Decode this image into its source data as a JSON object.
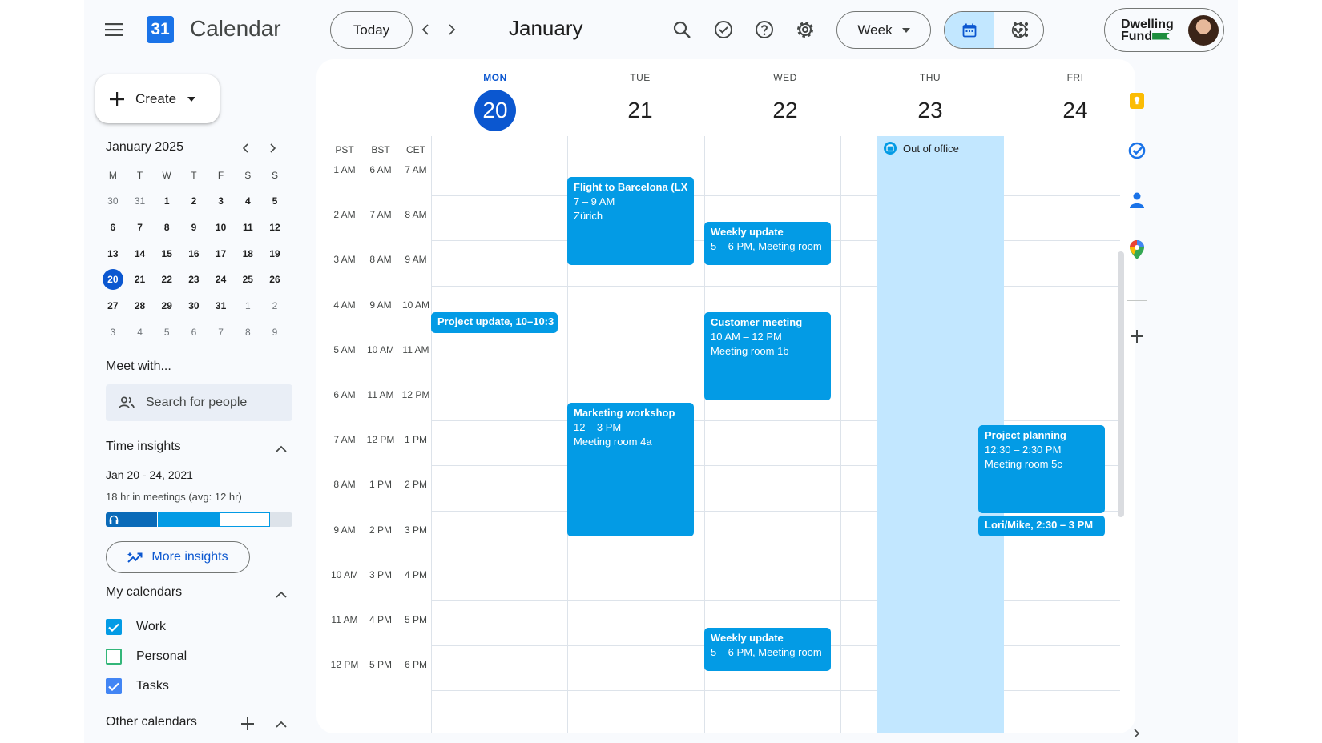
{
  "header": {
    "app_title": "Calendar",
    "logo_text": "31",
    "today_label": "Today",
    "month_title": "January",
    "view_label": "Week",
    "brand_line1": "Dwelling",
    "brand_line2": "Fund"
  },
  "sidebar": {
    "create_label": "Create",
    "mini_month_title": "January 2025",
    "weekday_initials": [
      "M",
      "T",
      "W",
      "T",
      "F",
      "S",
      "S"
    ],
    "mini_days": [
      {
        "d": "30",
        "muted": true
      },
      {
        "d": "31",
        "muted": true
      },
      {
        "d": "1"
      },
      {
        "d": "2"
      },
      {
        "d": "3"
      },
      {
        "d": "4"
      },
      {
        "d": "5"
      },
      {
        "d": "6"
      },
      {
        "d": "7"
      },
      {
        "d": "8"
      },
      {
        "d": "9"
      },
      {
        "d": "10"
      },
      {
        "d": "11"
      },
      {
        "d": "12"
      },
      {
        "d": "13"
      },
      {
        "d": "14"
      },
      {
        "d": "15"
      },
      {
        "d": "16"
      },
      {
        "d": "17"
      },
      {
        "d": "18"
      },
      {
        "d": "19"
      },
      {
        "d": "20",
        "selected": true
      },
      {
        "d": "21"
      },
      {
        "d": "22"
      },
      {
        "d": "23"
      },
      {
        "d": "24"
      },
      {
        "d": "25"
      },
      {
        "d": "26"
      },
      {
        "d": "27"
      },
      {
        "d": "28"
      },
      {
        "d": "29"
      },
      {
        "d": "30"
      },
      {
        "d": "31"
      },
      {
        "d": "1",
        "muted": true
      },
      {
        "d": "2",
        "muted": true
      },
      {
        "d": "3",
        "muted": true
      },
      {
        "d": "4",
        "muted": true
      },
      {
        "d": "5",
        "muted": true
      },
      {
        "d": "6",
        "muted": true
      },
      {
        "d": "7",
        "muted": true
      },
      {
        "d": "8",
        "muted": true
      },
      {
        "d": "9",
        "muted": true
      }
    ],
    "meet_with_title": "Meet with...",
    "search_people_placeholder": "Search for people",
    "time_insights": {
      "title": "Time insights",
      "range": "Jan 20 - 24, 2021",
      "summary": "18 hr in meetings (avg: 12 hr)",
      "more_label": "More insights"
    },
    "my_calendars_title": "My calendars",
    "my_calendars": [
      {
        "label": "Work",
        "checked": true
      },
      {
        "label": "Personal",
        "checked": false
      },
      {
        "label": "Tasks",
        "checked": true
      }
    ],
    "other_calendars_title": "Other calendars"
  },
  "week": {
    "days": [
      {
        "dow": "MON",
        "date": "20",
        "today": true
      },
      {
        "dow": "TUE",
        "date": "21"
      },
      {
        "dow": "WED",
        "date": "22"
      },
      {
        "dow": "THU",
        "date": "23"
      },
      {
        "dow": "FRI",
        "date": "24"
      }
    ],
    "timezones": [
      "PST",
      "BST",
      "CET"
    ],
    "time_rows": [
      [
        "1 AM",
        "6 AM",
        "7 AM"
      ],
      [
        "2 AM",
        "7 AM",
        "8 AM"
      ],
      [
        "3 AM",
        "8 AM",
        "9 AM"
      ],
      [
        "4 AM",
        "9 AM",
        "10 AM"
      ],
      [
        "5 AM",
        "10 AM",
        "11 AM"
      ],
      [
        "6 AM",
        "11 AM",
        "12 PM"
      ],
      [
        "7 AM",
        "12 PM",
        "1 PM"
      ],
      [
        "8 AM",
        "1 PM",
        "2 PM"
      ],
      [
        "9 AM",
        "2 PM",
        "3 PM"
      ],
      [
        "10 AM",
        "3 PM",
        "4 PM"
      ],
      [
        "11 AM",
        "4 PM",
        "5 PM"
      ],
      [
        "12 PM",
        "5 PM",
        "6 PM"
      ]
    ],
    "out_of_office_label": "Out of office",
    "events": {
      "flight": {
        "title": "Flight to Barcelona (LX",
        "line2": "7 – 9 AM",
        "line3": "Zürich"
      },
      "weekly1": {
        "title": "Weekly update",
        "line2": "5 – 6 PM, Meeting room"
      },
      "project_update": {
        "title": "Project update, 10–10:3"
      },
      "customer": {
        "title": "Customer meeting",
        "line2": "10 AM – 12 PM",
        "line3": "Meeting room 1b"
      },
      "marketing": {
        "title": "Marketing workshop",
        "line2": "12 – 3 PM",
        "line3": "Meeting room 4a"
      },
      "planning": {
        "title": "Project planning",
        "line2": "12:30 – 2:30 PM",
        "line3": "Meeting room 5c"
      },
      "lori": {
        "title": "Lori/Mike, 2:30 – 3 PM"
      },
      "weekly2": {
        "title": "Weekly update",
        "line2": "5 – 6 PM, Meeting room"
      }
    }
  },
  "icons": {
    "menu": "menu-icon",
    "search": "search-icon",
    "tasks": "check-circle-icon",
    "help": "help-icon",
    "settings": "gear-icon",
    "apps": "apps-grid-icon",
    "keep": "keep-icon",
    "maps": "maps-pin-icon",
    "contacts": "contacts-icon"
  },
  "colors": {
    "primary": "#0b57d0",
    "event": "#039be5",
    "out_of_office": "#c2e7ff",
    "keep": "#fbbc04"
  }
}
